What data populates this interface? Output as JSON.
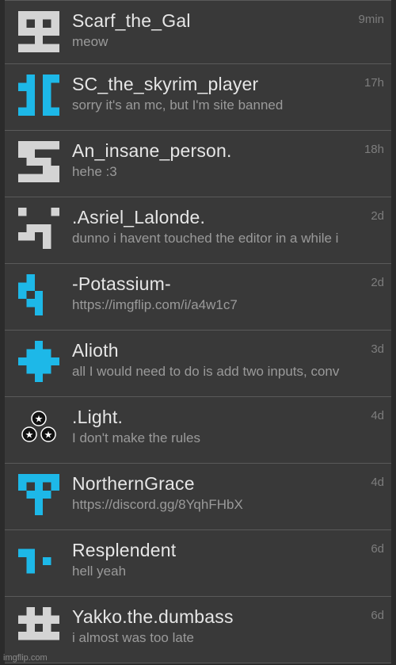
{
  "colors": {
    "background": "#2b2b2b",
    "row": "#393939",
    "divider": "#5a5a5a",
    "name_text": "#e6e6e6",
    "message_text": "#9a9a9a",
    "time_text": "#7d7d7d",
    "avatar_blue": "#1db8e8",
    "avatar_gray": "#d4d4d4"
  },
  "conversations": [
    {
      "name": "Scarf_the_Gal",
      "message": "meow",
      "time": "9min",
      "avatar_icon": "gray-pixel-identicon"
    },
    {
      "name": "SC_the_skyrim_player",
      "message": "sorry it's an mc, but I'm site banned",
      "time": "17h",
      "avatar_icon": "blue-pixel-identicon"
    },
    {
      "name": "An_insane_person.",
      "message": "hehe :3",
      "time": "18h",
      "avatar_icon": "gray-pixel-identicon"
    },
    {
      "name": ".Asriel_Lalonde.",
      "message": "dunno i havent touched the editor in a while i",
      "time": "2d",
      "avatar_icon": "gray-pixel-identicon"
    },
    {
      "name": "-Potassium-",
      "message": "https://imgflip.com/i/a4w1c7",
      "time": "2d",
      "avatar_icon": "blue-pixel-identicon"
    },
    {
      "name": "Alioth",
      "message": "all I would need to do is add two inputs, conv",
      "time": "3d",
      "avatar_icon": "blue-pixel-identicon"
    },
    {
      "name": ".Light.",
      "message": "I don't make the rules",
      "time": "4d",
      "avatar_icon": "three-stars-icon"
    },
    {
      "name": "NorthernGrace",
      "message": "https://discord.gg/8YqhFHbX",
      "time": "4d",
      "avatar_icon": "blue-pixel-identicon"
    },
    {
      "name": "Resplendent",
      "message": "hell yeah",
      "time": "6d",
      "avatar_icon": "blue-pixel-identicon"
    },
    {
      "name": "Yakko.the.dumbass",
      "message": "i almost was too late",
      "time": "6d",
      "avatar_icon": "gray-pixel-identicon"
    }
  ],
  "watermark": "imgflip.com"
}
